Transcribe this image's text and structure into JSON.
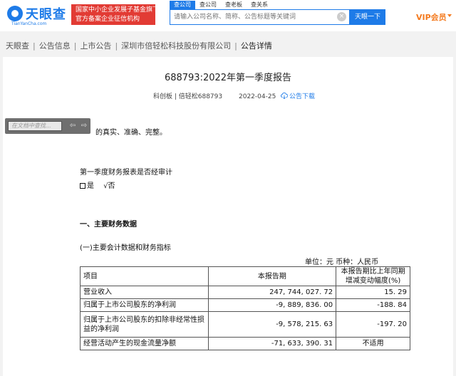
{
  "header": {
    "logo_text": "天眼查",
    "logo_subtext": "TianYanCha.com",
    "badge_line1": "国家中小企业发展子基金旗下",
    "badge_line2": "官方备案企业征信机构",
    "search_tabs": [
      "查公司",
      "查公司",
      "查老板",
      "查关系"
    ],
    "search_placeholder": "请输入公司名称、简称、公告标题等关键词",
    "search_button": "天眼一下",
    "vip_label": "VIP会员"
  },
  "breadcrumb": [
    "天眼查",
    "公告信息",
    "上市公告",
    "深圳市倍轻松科技股份有限公司",
    "公告详情"
  ],
  "document": {
    "title": "688793:2022年第一季度报告",
    "board": "科创板 | 倍轻松688793",
    "date": "2022-04-25",
    "download_label": "公告下载",
    "search_widget_placeholder": "在文档中查找...",
    "line_partial": "的真实、准确、完整。",
    "audit_question": "第一季度财务报表是否经审计",
    "audit_yes": "是",
    "audit_no": "√否",
    "section1_title": "一、主要财务数据",
    "section1_sub": "(一)主要会计数据和财务指标",
    "unit_note": "单位：元  币种：人民币",
    "table": {
      "col_item": "项目",
      "col_period": "本报告期",
      "col_change": "本报告期比上年同期增减变动幅度(%)",
      "rows": [
        {
          "item": "营业收入",
          "period": "247, 744, 027. 72",
          "change": "15. 29"
        },
        {
          "item": "归属于上市公司股东的净利润",
          "period": "-9, 889, 836. 00",
          "change": "-188. 84"
        },
        {
          "item": "归属于上市公司股东的扣除非经常性损益的净利润",
          "period": "-9, 578, 215. 63",
          "change": "-197. 20"
        },
        {
          "item": "经营活动产生的现金流量净额",
          "period": "-71, 633, 390. 31",
          "change": "不适用"
        }
      ]
    }
  },
  "colors": {
    "accent": "#1e7be8",
    "badge": "#e23b34",
    "vip": "#f47b20"
  }
}
